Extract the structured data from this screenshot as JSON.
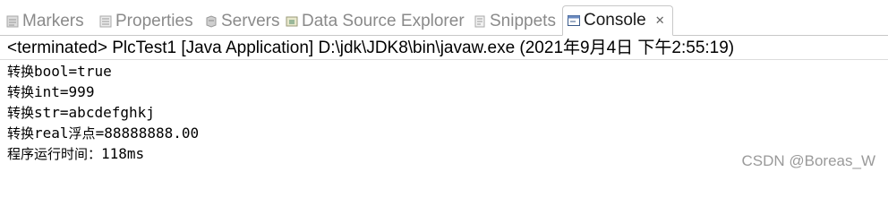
{
  "tabs": [
    {
      "label": "Markers",
      "icon": "markers-icon"
    },
    {
      "label": "Properties",
      "icon": "properties-icon"
    },
    {
      "label": "Servers",
      "icon": "servers-icon"
    },
    {
      "label": "Data Source Explorer",
      "icon": "data-source-explorer-icon"
    },
    {
      "label": "Snippets",
      "icon": "snippets-icon"
    },
    {
      "label": "Console",
      "icon": "console-icon",
      "active": true,
      "close_icon": "close-icon"
    }
  ],
  "header": "<terminated> PlcTest1 [Java Application] D:\\jdk\\JDK8\\bin\\javaw.exe (2021年9月4日 下午2:55:19)",
  "console_lines": [
    {
      "prefix": "转换",
      "text": "bool=true"
    },
    {
      "prefix": "转换",
      "text": "int=999"
    },
    {
      "prefix": "转换",
      "text": "str=abcdefghkj"
    },
    {
      "prefix": "转换",
      "text": "real",
      "suffix_cjk": "浮点",
      "rest": "=88888888.00"
    },
    {
      "prefix": "程序运行时间：",
      "text": "118ms"
    }
  ],
  "watermark": "CSDN @Boreas_W",
  "colors": {
    "active_tab_text": "#1a1a1a",
    "inactive_tab_text": "#8a8a8a",
    "console_text": "#000000"
  }
}
